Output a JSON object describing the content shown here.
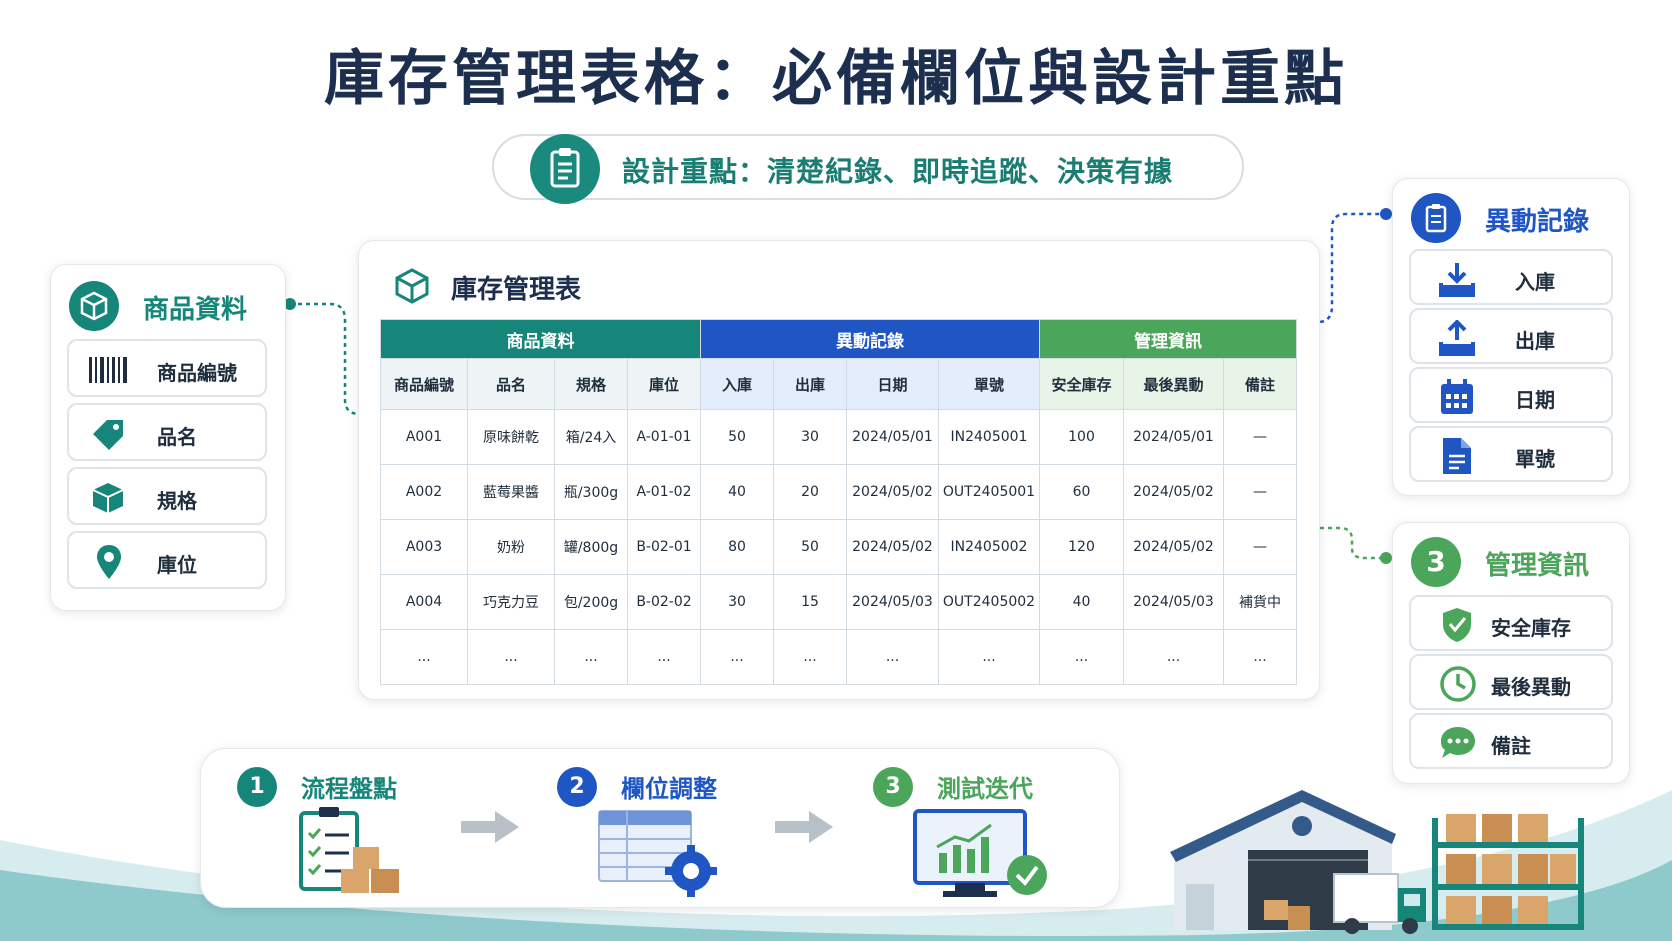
{
  "title": "庫存管理表格：必備欄位與設計重點",
  "subtitle": "設計重點：清楚紀錄、即時追蹤、決策有據",
  "left_panel": {
    "title": "商品資料",
    "items": [
      {
        "label": "商品編號",
        "icon": "barcode-icon"
      },
      {
        "label": "品名",
        "icon": "tag-icon"
      },
      {
        "label": "規格",
        "icon": "cube-icon"
      },
      {
        "label": "庫位",
        "icon": "location-pin-icon"
      }
    ]
  },
  "table_panel": {
    "title": "庫存管理表",
    "groups": [
      "商品資料",
      "異動記錄",
      "管理資訊"
    ],
    "columns": [
      "商品編號",
      "品名",
      "規格",
      "庫位",
      "入庫",
      "出庫",
      "日期",
      "單號",
      "安全庫存",
      "最後異動",
      "備註"
    ],
    "rows": [
      [
        "A001",
        "原味餅乾",
        "箱/24入",
        "A-01-01",
        "50",
        "30",
        "2024/05/01",
        "IN2405001",
        "100",
        "2024/05/01",
        "—"
      ],
      [
        "A002",
        "藍莓果醬",
        "瓶/300g",
        "A-01-02",
        "40",
        "20",
        "2024/05/02",
        "OUT2405001",
        "60",
        "2024/05/02",
        "—"
      ],
      [
        "A003",
        "奶粉",
        "罐/800g",
        "B-02-01",
        "80",
        "50",
        "2024/05/02",
        "IN2405002",
        "120",
        "2024/05/02",
        "—"
      ],
      [
        "A004",
        "巧克力豆",
        "包/200g",
        "B-02-02",
        "30",
        "15",
        "2024/05/03",
        "OUT2405002",
        "40",
        "2024/05/03",
        "補貨中"
      ],
      [
        "...",
        "...",
        "...",
        "...",
        "...",
        "...",
        "...",
        "...",
        "...",
        "...",
        "..."
      ]
    ]
  },
  "right_panel_top": {
    "title": "異動記錄",
    "items": [
      {
        "label": "入庫",
        "icon": "inbound-tray-icon"
      },
      {
        "label": "出庫",
        "icon": "outbound-tray-icon"
      },
      {
        "label": "日期",
        "icon": "calendar-icon"
      },
      {
        "label": "單號",
        "icon": "document-icon"
      }
    ]
  },
  "right_panel_bottom": {
    "badge": "3",
    "title": "管理資訊",
    "items": [
      {
        "label": "安全庫存",
        "icon": "shield-check-icon"
      },
      {
        "label": "最後異動",
        "icon": "clock-icon"
      },
      {
        "label": "備註",
        "icon": "chat-bubble-icon"
      }
    ]
  },
  "flow": [
    {
      "num": "1",
      "label": "流程盤點",
      "icon": "checklist-boxes-icon"
    },
    {
      "num": "2",
      "label": "欄位調整",
      "icon": "table-gear-icon"
    },
    {
      "num": "3",
      "label": "測試迭代",
      "icon": "monitor-chart-icon"
    }
  ],
  "colors": {
    "teal": "#17867a",
    "blue": "#1f56c4",
    "green": "#4ba55a",
    "navy": "#1c2f4f"
  }
}
